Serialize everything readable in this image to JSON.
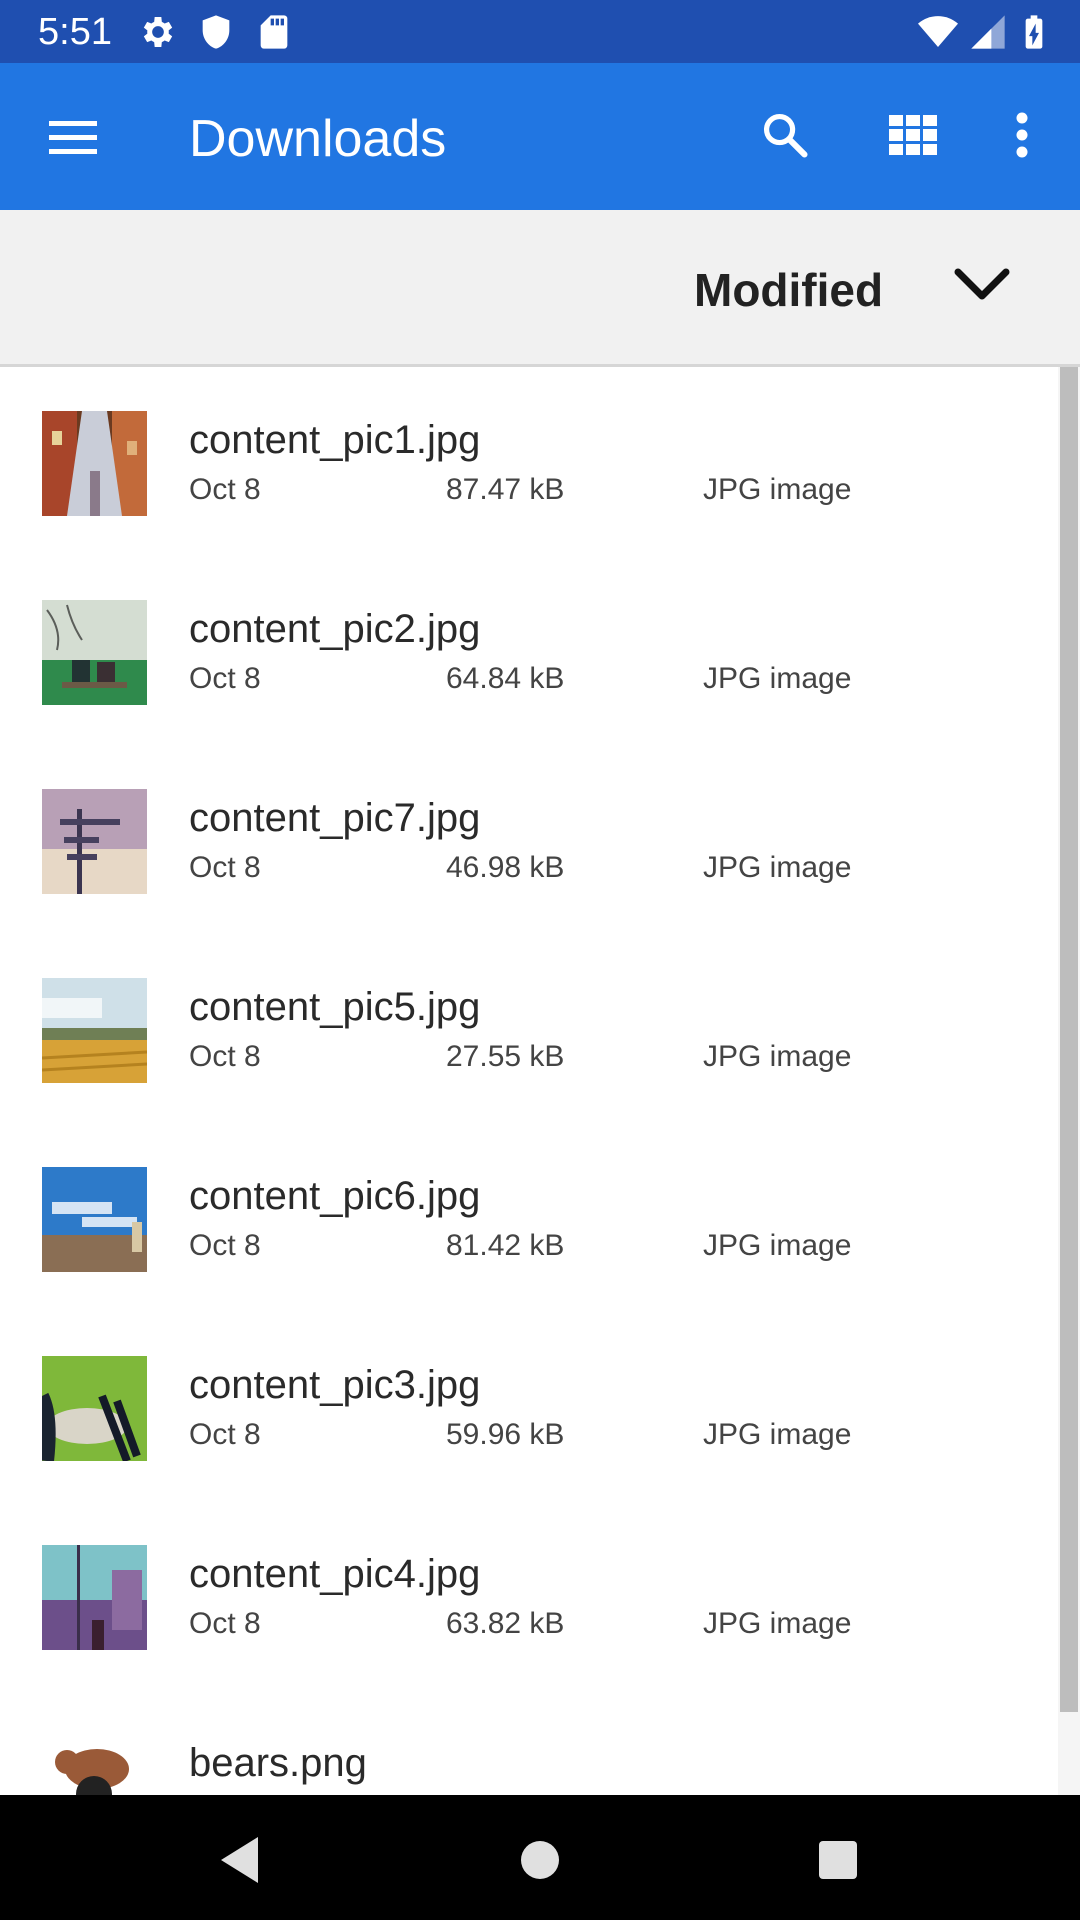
{
  "status_bar": {
    "time": "5:51",
    "icons": [
      "gear-icon",
      "shield-icon",
      "sd-card-icon",
      "wifi-icon",
      "cell-signal-icon",
      "battery-charging-icon"
    ]
  },
  "app_bar": {
    "title": "Downloads",
    "menu_icon": "hamburger-menu-icon",
    "search_icon": "search-icon",
    "grid_icon": "grid-view-icon",
    "overflow_icon": "more-vert-icon",
    "background_color": "#2176e2"
  },
  "sort_bar": {
    "label": "Modified",
    "icon": "chevron-down-icon"
  },
  "files": [
    {
      "name": "content_pic1.jpg",
      "date": "Oct 8",
      "size": "87.47 kB",
      "type": "JPG image",
      "thumb": "street"
    },
    {
      "name": "content_pic2.jpg",
      "date": "Oct 8",
      "size": "64.84 kB",
      "type": "JPG image",
      "thumb": "bench"
    },
    {
      "name": "content_pic7.jpg",
      "date": "Oct 8",
      "size": "46.98 kB",
      "type": "JPG image",
      "thumb": "signpost"
    },
    {
      "name": "content_pic5.jpg",
      "date": "Oct 8",
      "size": "27.55 kB",
      "type": "JPG image",
      "thumb": "field"
    },
    {
      "name": "content_pic6.jpg",
      "date": "Oct 8",
      "size": "81.42 kB",
      "type": "JPG image",
      "thumb": "sky"
    },
    {
      "name": "content_pic3.jpg",
      "date": "Oct 8",
      "size": "59.96 kB",
      "type": "JPG image",
      "thumb": "grass"
    },
    {
      "name": "content_pic4.jpg",
      "date": "Oct 8",
      "size": "63.82 kB",
      "type": "JPG image",
      "thumb": "plaza"
    },
    {
      "name": "bears.png",
      "date": "",
      "size": "",
      "type": "",
      "thumb": "bears"
    }
  ],
  "nav_bar": {
    "back_icon": "back-triangle-icon",
    "home_icon": "home-circle-icon",
    "recents_icon": "recents-square-icon"
  }
}
